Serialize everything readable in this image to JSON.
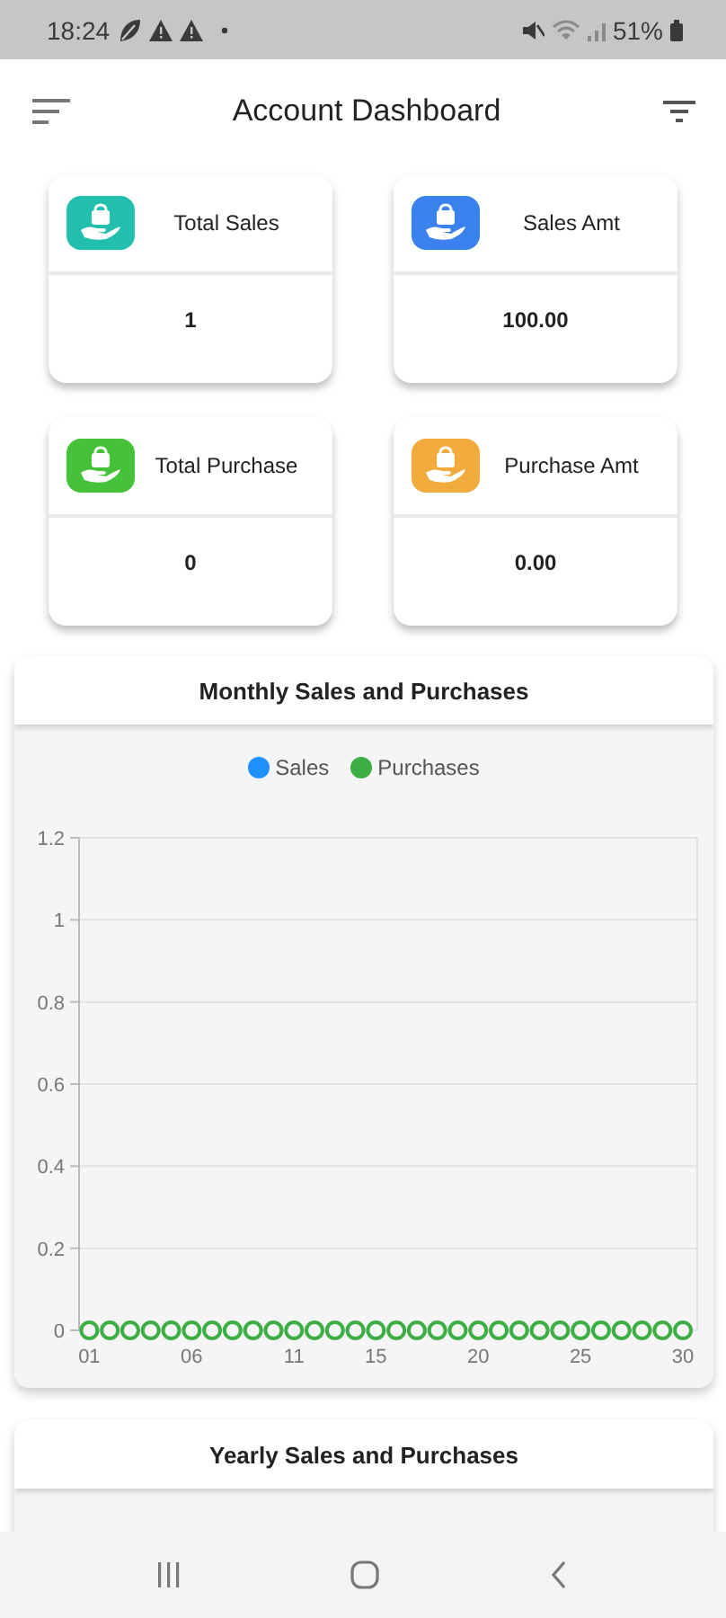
{
  "status_bar": {
    "time": "18:24",
    "battery": "51%"
  },
  "app_bar": {
    "title": "Account Dashboard"
  },
  "stats": [
    {
      "label": "Total Sales",
      "value": "1",
      "color": "#22bfae"
    },
    {
      "label": "Sales Amt",
      "value": "100.00",
      "color": "#3b82ef"
    },
    {
      "label": "Total Purchase",
      "value": "0",
      "color": "#45c23a"
    },
    {
      "label": "Purchase Amt",
      "value": "0.00",
      "color": "#f0ab3c"
    }
  ],
  "monthly_chart": {
    "title": "Monthly Sales and Purchases",
    "chart_data": {
      "type": "scatter",
      "x": [
        1,
        2,
        3,
        4,
        5,
        6,
        7,
        8,
        9,
        10,
        11,
        12,
        13,
        14,
        15,
        16,
        17,
        18,
        19,
        20,
        21,
        22,
        23,
        24,
        25,
        26,
        27,
        28,
        29,
        30
      ],
      "series": [
        {
          "name": "Sales",
          "color": "#1e90ff",
          "values": [
            null,
            null,
            null,
            null,
            null,
            null,
            null,
            null,
            null,
            null,
            null,
            null,
            null,
            null,
            null,
            null,
            null,
            null,
            null,
            null,
            null,
            null,
            null,
            null,
            null,
            null,
            null,
            null,
            null,
            null
          ]
        },
        {
          "name": "Purchases",
          "color": "#3cae43",
          "values": [
            0,
            0,
            0,
            0,
            0,
            0,
            0,
            0,
            0,
            0,
            0,
            0,
            0,
            0,
            0,
            0,
            0,
            0,
            0,
            0,
            0,
            0,
            0,
            0,
            0,
            0,
            0,
            0,
            0,
            0
          ]
        }
      ],
      "xlim": [
        0.5,
        30.7
      ],
      "ylim": [
        0,
        1.2
      ],
      "yticks": [
        0,
        0.2,
        0.4,
        0.6,
        0.8,
        1,
        1.2
      ],
      "xticks": [
        {
          "value": 1,
          "label": "01"
        },
        {
          "value": 6,
          "label": "06"
        },
        {
          "value": 11,
          "label": "11"
        },
        {
          "value": 15,
          "label": "15"
        },
        {
          "value": 20,
          "label": "20"
        },
        {
          "value": 25,
          "label": "25"
        },
        {
          "value": 30,
          "label": "30"
        }
      ],
      "grid": true,
      "legend": "top"
    }
  },
  "yearly_chart": {
    "title": "Yearly Sales and Purchases"
  }
}
